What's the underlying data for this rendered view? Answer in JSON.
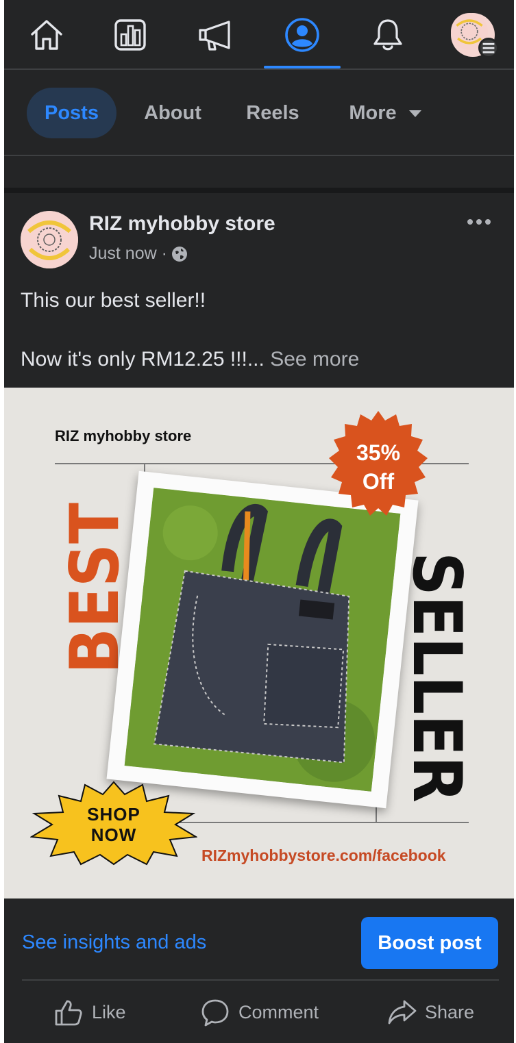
{
  "nav": {
    "items": [
      {
        "icon": "home-icon"
      },
      {
        "icon": "dashboard-icon"
      },
      {
        "icon": "megaphone-icon"
      },
      {
        "icon": "profile-icon",
        "active": true
      },
      {
        "icon": "bell-icon"
      },
      {
        "icon": "avatar-menu"
      }
    ],
    "accent": "#2d88ff"
  },
  "tabs": [
    {
      "label": "Posts",
      "active": true
    },
    {
      "label": "About"
    },
    {
      "label": "Reels"
    },
    {
      "label": "More"
    }
  ],
  "post": {
    "author": "RIZ myhobby store",
    "time": "Just now ·",
    "text_line1": "This our best seller!!",
    "text_line2": "Now it's only RM12.25 !!!...",
    "see_more": "See more",
    "ad": {
      "store": "RIZ myhobby store",
      "badge_line1": "35%",
      "badge_line2": "Off",
      "best": "BEST",
      "seller": "SELLER",
      "shop_line1": "SHOP",
      "shop_line2": "NOW",
      "url": "RIZmyhobbystore.com/facebook",
      "colors": {
        "orange": "#d9531e",
        "yellow": "#f7c21e",
        "background": "#e6e4e0"
      }
    }
  },
  "footer": {
    "insights_link": "See insights and ads",
    "boost_button": "Boost post",
    "actions": [
      {
        "label": "Like",
        "icon": "thumbs-up-icon"
      },
      {
        "label": "Comment",
        "icon": "comment-icon"
      },
      {
        "label": "Share",
        "icon": "share-icon"
      }
    ]
  }
}
